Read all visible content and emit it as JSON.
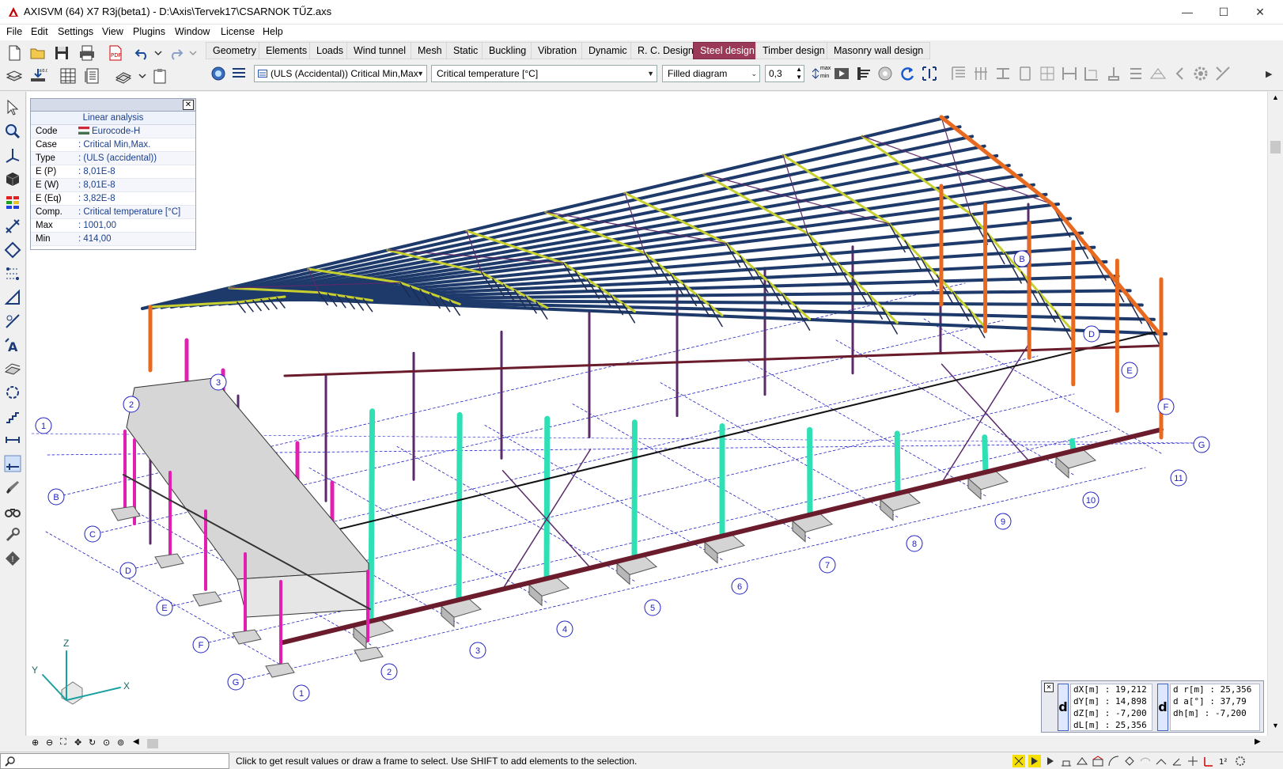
{
  "window": {
    "title": "AXISVM (64) X7 R3j(beta1) - D:\\Axis\\Tervek17\\CSARNOK TŰZ.axs",
    "minimize": "—",
    "maximize": "☐",
    "close": "✕"
  },
  "menu": [
    "File",
    "Edit",
    "Settings",
    "View",
    "Plugins",
    "Window",
    "License",
    "Help"
  ],
  "tabs": [
    "Geometry",
    "Elements",
    "Loads",
    "Wind tunnel",
    "Mesh",
    "Static",
    "Buckling",
    "Vibration",
    "Dynamic",
    "R. C. Design",
    "Steel design",
    "Timber design",
    "Masonry wall design"
  ],
  "active_tab": "Steel design",
  "combos": {
    "load_case": "(ULS (Accidental)) Critical Min,Max",
    "component": "Critical temperature [°C]",
    "display_mode": "Filled diagram",
    "scale": "0,3"
  },
  "toolbar_extra": {
    "max_label": "max",
    "min_label": "min"
  },
  "info_panel": {
    "title": "Linear analysis",
    "rows": [
      {
        "key": "Code",
        "value": "Eurocode-H"
      },
      {
        "key": "Case",
        "value": ": Critical Min,Max."
      },
      {
        "key": "Type",
        "value": ": (ULS (accidental))"
      },
      {
        "key": "E (P)",
        "value": ": 8,01E-8"
      },
      {
        "key": "E (W)",
        "value": ": 8,01E-8"
      },
      {
        "key": "E (Eq)",
        "value": ": 3,82E-8"
      },
      {
        "key": "Comp.",
        "value": ": Critical temperature [°C]"
      },
      {
        "key": "Max",
        "value": ": 1001,00"
      },
      {
        "key": "Min",
        "value": ": 414,00"
      }
    ]
  },
  "coords": {
    "left": [
      "dX[m] : 19,212",
      "dY[m] : 14,898",
      "dZ[m] : -7,200",
      "dL[m] : 25,356"
    ],
    "right": [
      "d r[m] : 25,356",
      "d a[°] : 37,79",
      "dh[m] : -7,200"
    ],
    "d_label": "d"
  },
  "axes": {
    "x": "X",
    "y": "Y",
    "z": "Z"
  },
  "grid_letters": [
    "B",
    "C",
    "D",
    "E",
    "F",
    "G"
  ],
  "grid_letters_right": [
    "B",
    "D",
    "E",
    "F",
    "G"
  ],
  "grid_numbers": [
    "1",
    "2",
    "3",
    "4",
    "5",
    "6",
    "7",
    "8",
    "9",
    "10",
    "11"
  ],
  "grid_left_extra": [
    "1",
    "2",
    "3"
  ],
  "status": {
    "message": "Click to get result values or draw a frame to select. Use SHIFT to add elements to the selection."
  },
  "colors": {
    "active_tab": "#9a3a58",
    "purlin": "#1d3a6b",
    "column_cyan": "#2fe0b4",
    "column_magenta": "#e020b0",
    "column_orange": "#e86a20",
    "base_beam": "#6a1c2c",
    "brace": "#5a2a6a",
    "grid_blue": "#2020c0"
  }
}
